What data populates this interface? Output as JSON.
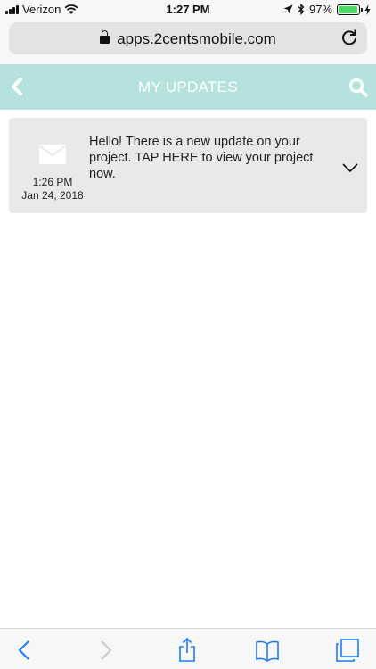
{
  "status_bar": {
    "carrier": "Verizon",
    "time": "1:27 PM",
    "battery_percent": "97%",
    "battery_level": 0.97,
    "battery_color": "#4cd964"
  },
  "browser": {
    "url": "apps.2centsmobile.com"
  },
  "header": {
    "title": "MY UPDATES",
    "background": "#b5e1df"
  },
  "updates": [
    {
      "icon": "envelope-icon",
      "time": "1:26 PM",
      "date": "Jan 24, 2018",
      "message": "Hello! There is a new update on your project. TAP HERE to view your project now."
    }
  ],
  "toolbar": {
    "buttons": [
      "back-icon",
      "forward-icon",
      "share-icon",
      "bookmarks-icon",
      "tabs-icon"
    ]
  }
}
